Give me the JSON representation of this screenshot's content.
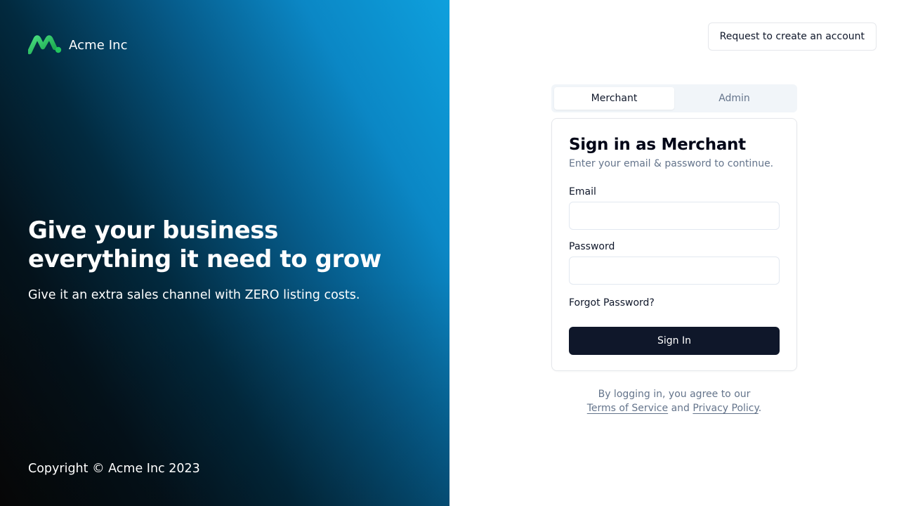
{
  "brand": {
    "name": "Acme Inc",
    "logo_icon": "acme-logo-icon",
    "logo_color_start": "#22c55e",
    "logo_color_end": "#16a34a"
  },
  "hero": {
    "title": "Give your business everything it need to grow",
    "subtitle": "Give it an extra sales channel with ZERO listing costs.",
    "copyright": "Copyright © Acme Inc 2023"
  },
  "header": {
    "request_account_label": "Request to create an account"
  },
  "tabs": [
    {
      "label": "Merchant",
      "active": true
    },
    {
      "label": "Admin",
      "active": false
    }
  ],
  "form": {
    "title": "Sign in as Merchant",
    "subtitle": "Enter your email & password to continue.",
    "email_label": "Email",
    "email_value": "",
    "email_placeholder": "",
    "password_label": "Password",
    "password_value": "",
    "password_placeholder": "",
    "forgot_label": "Forgot Password?",
    "submit_label": "Sign In"
  },
  "legal": {
    "prefix": "By logging in, you agree to our",
    "terms_label": "Terms of Service",
    "and": "and",
    "privacy_label": "Privacy Policy",
    "suffix": "."
  },
  "colors": {
    "primary_button": "#0f172a",
    "muted_text": "#64748b",
    "border": "#e5e7eb",
    "tab_background": "#f1f5f9"
  }
}
